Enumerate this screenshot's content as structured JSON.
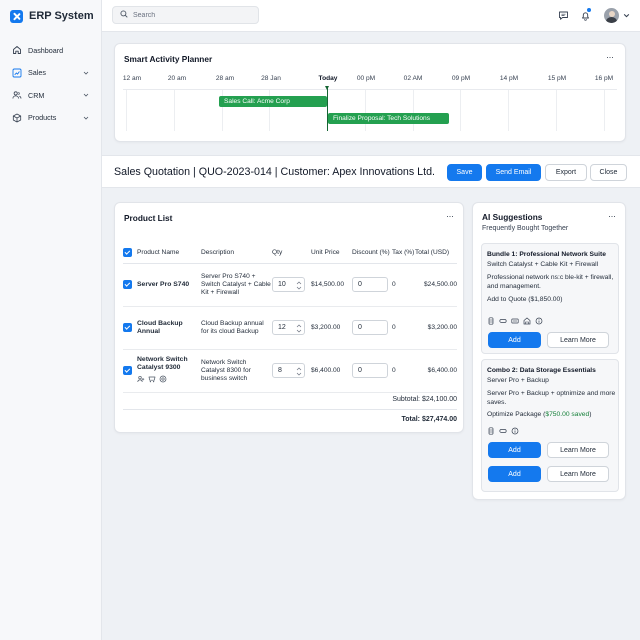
{
  "app": {
    "title": "ERP System"
  },
  "sidebar": {
    "items": [
      {
        "label": "Dashboard"
      },
      {
        "label": "Sales"
      },
      {
        "label": "CRM"
      },
      {
        "label": "Products"
      }
    ]
  },
  "topbar": {
    "search_placeholder": "Search"
  },
  "planner": {
    "title": "Smart Activity Planner",
    "timeline_labels": [
      "12 am",
      "20 am",
      "28 am",
      "28 Jan",
      "Today",
      "00 pM",
      "02 AM",
      "09 pM",
      "14 pM",
      "15 pM",
      "16 pM"
    ],
    "events": [
      {
        "label": "Sales Call: Acme Corp"
      },
      {
        "label": "Finalize Proposal: Tech Solutions"
      }
    ]
  },
  "quote": {
    "title": "Sales Quotation | QUO-2023-014 | Customer: Apex Innovations Ltd.",
    "save_label": "Save",
    "send_email_label": "Send Email",
    "export_label": "Export",
    "close_label": "Close"
  },
  "product_list": {
    "title": "Product List",
    "columns": [
      "Product Name",
      "Description",
      "Qty",
      "Unit Price",
      "Discount (%)",
      "Tax (%)",
      "Total (USD)"
    ],
    "rows": [
      {
        "name": "Server Pro S740",
        "desc": "Server Pro S740 + Switch Catalyst + Cable Kit + Firewall",
        "qty": "10",
        "unit_price": "$14,500.00",
        "discount": "0",
        "tax": "0",
        "total": "$24,500.00"
      },
      {
        "name": "Cloud Backup Annual",
        "desc": "Cloud Backup annual for its cloud Backup",
        "qty": "12",
        "unit_price": "$3,200.00",
        "discount": "0",
        "tax": "0",
        "total": "$3,200.00"
      },
      {
        "name": "Network Switch Catalyst 9300",
        "desc": "Network Switch Catalyst 8300 for business switch",
        "qty": "8",
        "unit_price": "$6,400.00",
        "discount": "0",
        "tax": "0",
        "total": "$6,400.00"
      }
    ],
    "subtotal_label": "Subtotal:",
    "subtotal_value": "$24,100.00",
    "total_label": "Total:",
    "total_value": "$27,474.00"
  },
  "ai": {
    "title": "AI Suggestions",
    "subtitle": "Frequently Bought Together",
    "bundle1": {
      "title": "Bundle 1: Professional Network Suite",
      "line1": "Switch Catalyst + Cable Kit + Firewall",
      "line2": "Professional network ns:c ble-kit + firewall, and management.",
      "line3": "Add to Quote ($1,850.00)",
      "add_label": "Add",
      "learn_label": "Learn More"
    },
    "bundle2": {
      "title": "Combo 2: Data Storage Essentials",
      "line1": "Server Pro + Backup",
      "line2": "Server Pro + Backup + optnimize and more saves.",
      "line3_prefix": "Optimize Package (",
      "line3_green": "$750.00 saved",
      "line3_suffix": ")",
      "add_label": "Add",
      "learn_label": "Learn More",
      "add2_label": "Add",
      "learn2_label": "Learn More"
    }
  },
  "colors": {
    "accent": "#1479ee",
    "timeline_bar": "#24a050",
    "today_marker": "#166534",
    "saved_text": "#16803a"
  }
}
